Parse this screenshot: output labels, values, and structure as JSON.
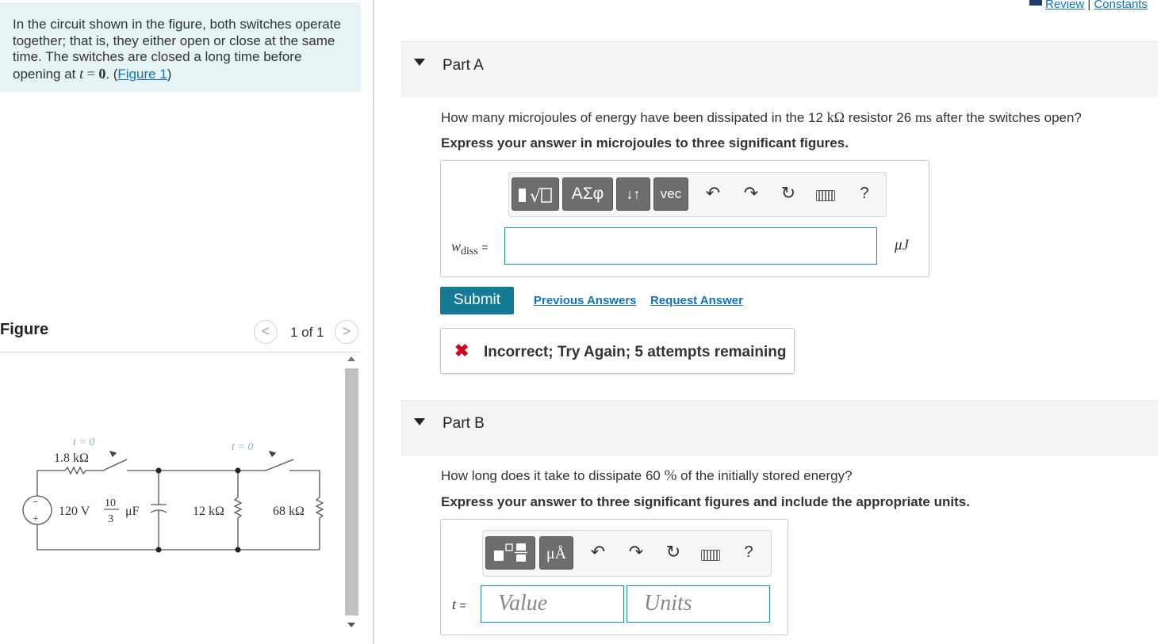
{
  "problem": {
    "text": "In the circuit shown in the figure, both switches operate together; that is, they either open or close at the same time. The switches are closed a long time before opening at ",
    "t_expr": "t = 0",
    "link_label": "Figure 1"
  },
  "header_links": {
    "review": "Review",
    "separator": "|",
    "constants": "Constants"
  },
  "figure": {
    "title": "Figure",
    "pager": "1 of 1",
    "circuit": {
      "switch1_label": "t = 0",
      "switch2_label": "t = 0",
      "resistor1": "1.8 kΩ",
      "source": "120 V",
      "capacitor_num": "10",
      "capacitor_den": "3",
      "capacitor_unit": "μF",
      "resistor2": "12 kΩ",
      "resistor3": "68 kΩ",
      "minus": "−",
      "plus": "+"
    }
  },
  "partA": {
    "title": "Part A",
    "question_pre": "How many microjoules of energy have been dissipated in the 12 ",
    "question_unit1": "kΩ",
    "question_mid": " resistor 26 ",
    "question_unit2": "ms",
    "question_post": " after the switches open?",
    "instruction": "Express your answer in microjoules to three significant figures.",
    "toolbar": {
      "sym_label": "ΑΣφ",
      "arrows_label": "↓↑",
      "vec_label": "vec",
      "help": "?"
    },
    "var_label": "w",
    "var_sub": "diss",
    "equals": "=",
    "input_value": "",
    "unit": "μJ",
    "submit": "Submit",
    "previous_answers": "Previous Answers",
    "request_answer": "Request Answer",
    "feedback": "Incorrect; Try Again; 5 attempts remaining"
  },
  "partB": {
    "title": "Part B",
    "question_pre": "How long does it take to dissipate 60 ",
    "question_pct": "%",
    "question_post": " of the initially stored energy?",
    "instruction": "Express your answer to three significant figures and include the appropriate units.",
    "toolbar": {
      "units_label": "μÅ",
      "help": "?"
    },
    "var_label": "t",
    "equals": "=",
    "value_placeholder": "Value",
    "units_placeholder": "Units"
  },
  "colors": {
    "accent": "#157a94",
    "link": "#1473b8",
    "problem_bg": "#e6f4f5",
    "error": "#d0021b"
  }
}
